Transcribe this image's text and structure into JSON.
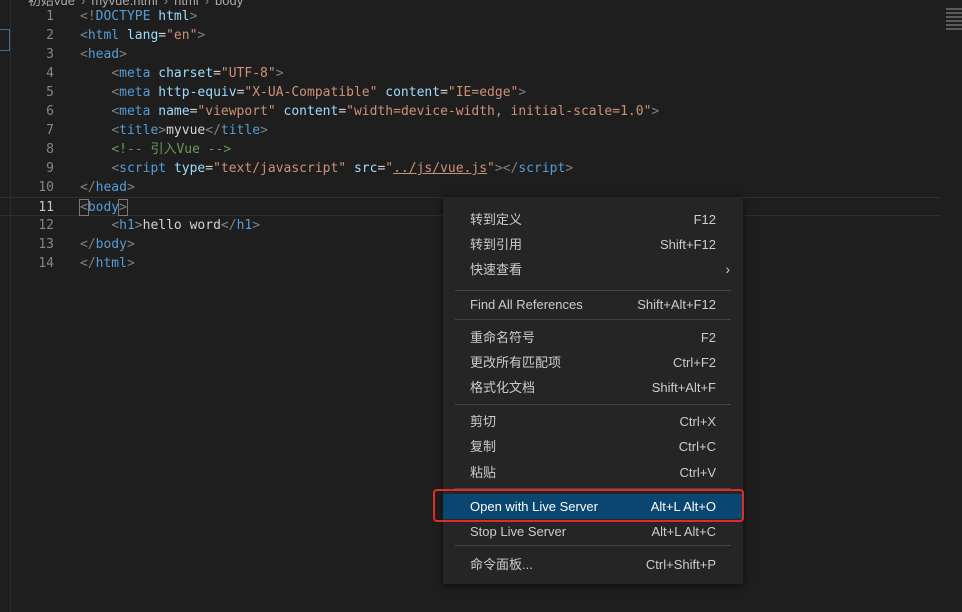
{
  "breadcrumb": [
    "初始vue",
    "myvue.html",
    "html",
    "body"
  ],
  "editor": {
    "active_line": "11",
    "lines": [
      {
        "n": "1",
        "parts": [
          [
            "p",
            "<!"
          ],
          [
            "t",
            "DOCTYPE"
          ],
          [
            "x",
            " "
          ],
          [
            "a",
            "html"
          ],
          [
            "p",
            ">"
          ]
        ]
      },
      {
        "n": "2",
        "parts": [
          [
            "p",
            "<"
          ],
          [
            "t",
            "html"
          ],
          [
            "x",
            " "
          ],
          [
            "a",
            "lang"
          ],
          [
            "x",
            "="
          ],
          [
            "s",
            "\"en\""
          ],
          [
            "p",
            ">"
          ]
        ]
      },
      {
        "n": "3",
        "parts": [
          [
            "p",
            "<"
          ],
          [
            "t",
            "head"
          ],
          [
            "p",
            ">"
          ]
        ]
      },
      {
        "n": "4",
        "parts": [
          [
            "x",
            "    "
          ],
          [
            "p",
            "<"
          ],
          [
            "t",
            "meta"
          ],
          [
            "x",
            " "
          ],
          [
            "a",
            "charset"
          ],
          [
            "x",
            "="
          ],
          [
            "s",
            "\"UTF-8\""
          ],
          [
            "p",
            ">"
          ]
        ]
      },
      {
        "n": "5",
        "parts": [
          [
            "x",
            "    "
          ],
          [
            "p",
            "<"
          ],
          [
            "t",
            "meta"
          ],
          [
            "x",
            " "
          ],
          [
            "a",
            "http-equiv"
          ],
          [
            "x",
            "="
          ],
          [
            "s",
            "\"X-UA-Compatible\""
          ],
          [
            "x",
            " "
          ],
          [
            "a",
            "content"
          ],
          [
            "x",
            "="
          ],
          [
            "s",
            "\"IE=edge\""
          ],
          [
            "p",
            ">"
          ]
        ]
      },
      {
        "n": "6",
        "parts": [
          [
            "x",
            "    "
          ],
          [
            "p",
            "<"
          ],
          [
            "t",
            "meta"
          ],
          [
            "x",
            " "
          ],
          [
            "a",
            "name"
          ],
          [
            "x",
            "="
          ],
          [
            "s",
            "\"viewport\""
          ],
          [
            "x",
            " "
          ],
          [
            "a",
            "content"
          ],
          [
            "x",
            "="
          ],
          [
            "s",
            "\"width=device-width, initial-scale=1.0\""
          ],
          [
            "p",
            ">"
          ]
        ]
      },
      {
        "n": "7",
        "parts": [
          [
            "x",
            "    "
          ],
          [
            "p",
            "<"
          ],
          [
            "t",
            "title"
          ],
          [
            "p",
            ">"
          ],
          [
            "x",
            "myvue"
          ],
          [
            "p",
            "</"
          ],
          [
            "t",
            "title"
          ],
          [
            "p",
            ">"
          ]
        ]
      },
      {
        "n": "8",
        "parts": [
          [
            "x",
            "    "
          ],
          [
            "c",
            "<!-- 引入Vue -->"
          ]
        ]
      },
      {
        "n": "9",
        "parts": [
          [
            "x",
            "    "
          ],
          [
            "p",
            "<"
          ],
          [
            "t",
            "script"
          ],
          [
            "x",
            " "
          ],
          [
            "a",
            "type"
          ],
          [
            "x",
            "="
          ],
          [
            "s",
            "\"text/javascript\""
          ],
          [
            "x",
            " "
          ],
          [
            "a",
            "src"
          ],
          [
            "x",
            "="
          ],
          [
            "s",
            "\""
          ],
          [
            "su",
            "../js/vue.js"
          ],
          [
            "s",
            "\""
          ],
          [
            "p",
            "></"
          ],
          [
            "t",
            "script"
          ],
          [
            "p",
            ">"
          ]
        ]
      },
      {
        "n": "10",
        "parts": [
          [
            "p",
            "</"
          ],
          [
            "t",
            "head"
          ],
          [
            "p",
            ">"
          ]
        ]
      },
      {
        "n": "11",
        "parts": [
          [
            "pm",
            "<"
          ],
          [
            "t",
            "body"
          ],
          [
            "pm",
            ">"
          ]
        ]
      },
      {
        "n": "12",
        "parts": [
          [
            "x",
            "    "
          ],
          [
            "p",
            "<"
          ],
          [
            "t",
            "h1"
          ],
          [
            "p",
            ">"
          ],
          [
            "x",
            "hello word"
          ],
          [
            "p",
            "</"
          ],
          [
            "t",
            "h1"
          ],
          [
            "p",
            ">"
          ]
        ]
      },
      {
        "n": "13",
        "parts": [
          [
            "p",
            "</"
          ],
          [
            "t",
            "body"
          ],
          [
            "p",
            ">"
          ]
        ]
      },
      {
        "n": "14",
        "parts": [
          [
            "p",
            "</"
          ],
          [
            "t",
            "html"
          ],
          [
            "p",
            ">"
          ]
        ]
      }
    ]
  },
  "context_menu": {
    "groups": [
      [
        {
          "id": "go-to-definition",
          "label": "转到定义",
          "key": "F12"
        },
        {
          "id": "go-to-references",
          "label": "转到引用",
          "key": "Shift+F12"
        },
        {
          "id": "peek",
          "label": "快速查看",
          "key": "",
          "submenu": true
        }
      ],
      [
        {
          "id": "find-all-references",
          "label": "Find All References",
          "key": "Shift+Alt+F12"
        }
      ],
      [
        {
          "id": "rename-symbol",
          "label": "重命名符号",
          "key": "F2"
        },
        {
          "id": "change-all-occurrences",
          "label": "更改所有匹配项",
          "key": "Ctrl+F2"
        },
        {
          "id": "format-document",
          "label": "格式化文档",
          "key": "Shift+Alt+F"
        }
      ],
      [
        {
          "id": "cut",
          "label": "剪切",
          "key": "Ctrl+X"
        },
        {
          "id": "copy",
          "label": "复制",
          "key": "Ctrl+C"
        },
        {
          "id": "paste",
          "label": "粘贴",
          "key": "Ctrl+V"
        }
      ],
      [
        {
          "id": "open-with-live-server",
          "label": "Open with Live Server",
          "key": "Alt+L Alt+O",
          "highlighted": true
        },
        {
          "id": "stop-live-server",
          "label": "Stop Live Server",
          "key": "Alt+L Alt+C"
        }
      ],
      [
        {
          "id": "command-palette",
          "label": "命令面板...",
          "key": "Ctrl+Shift+P"
        }
      ]
    ]
  },
  "colors": {
    "editor_bg": "#1e1e1e",
    "menu_bg": "#252526",
    "menu_highlight": "#094771",
    "annotation_box": "#e02b2b",
    "tag": "#569cd6",
    "attr": "#9cdcfe",
    "string": "#ce9178",
    "comment": "#6a9955"
  }
}
